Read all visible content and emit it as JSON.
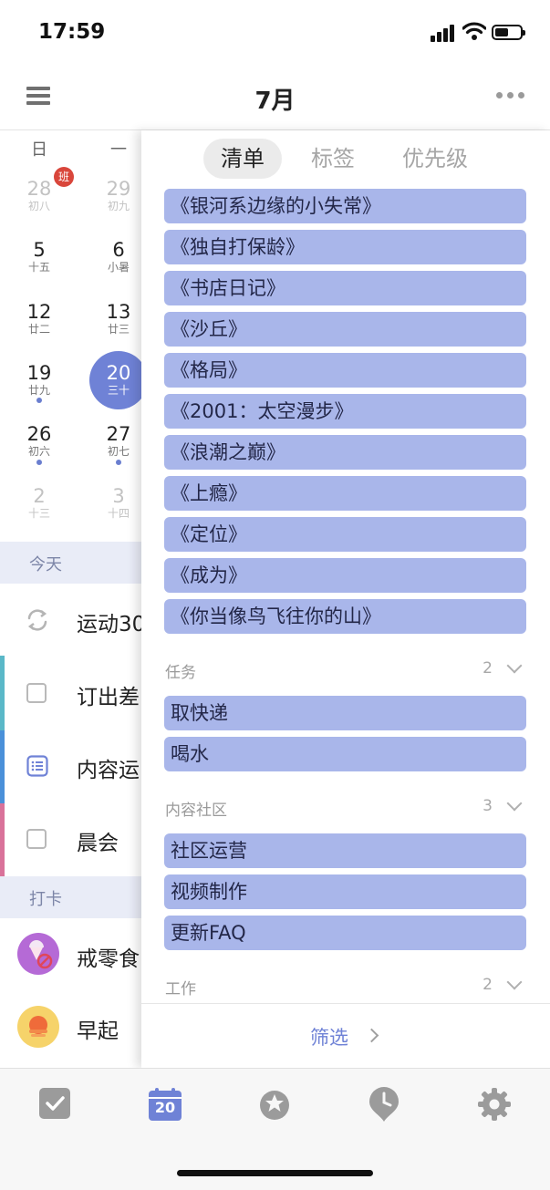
{
  "status": {
    "time": "17:59"
  },
  "header": {
    "title": "7月"
  },
  "calendar": {
    "weekdays": [
      "日",
      "一"
    ],
    "badge": "班",
    "rows": [
      [
        {
          "d": "28",
          "l": "初八",
          "dim": true
        },
        {
          "d": "29",
          "l": "初九",
          "dim": true
        }
      ],
      [
        {
          "d": "5",
          "l": "十五"
        },
        {
          "d": "6",
          "l": "小暑"
        }
      ],
      [
        {
          "d": "12",
          "l": "廿二"
        },
        {
          "d": "13",
          "l": "廿三"
        }
      ],
      [
        {
          "d": "19",
          "l": "廿九"
        },
        {
          "d": "20",
          "l": "三十",
          "selected": true
        }
      ],
      [
        {
          "d": "26",
          "l": "初六"
        },
        {
          "d": "27",
          "l": "初七"
        }
      ],
      [
        {
          "d": "2",
          "l": "十三",
          "dim": true
        },
        {
          "d": "3",
          "l": "十四",
          "dim": true
        }
      ]
    ]
  },
  "today": {
    "section_label": "今天",
    "tasks": [
      {
        "text": "运动30",
        "icon": "repeat-icon"
      },
      {
        "text": "订出差",
        "icon": "checkbox"
      },
      {
        "text": "内容运",
        "icon": "list-note-icon"
      },
      {
        "text": "晨会",
        "icon": "checkbox"
      }
    ]
  },
  "habits": {
    "section_label": "打卡",
    "items": [
      {
        "text": "戒零食",
        "icon": "no-snack-icon"
      },
      {
        "text": "早起",
        "icon": "sunrise-icon"
      }
    ]
  },
  "panel": {
    "segments": [
      "清单",
      "标签",
      "优先级"
    ],
    "active_segment": "清单",
    "lists": [
      "《银河系边缘的小失常》",
      "《独自打保龄》",
      "《书店日记》",
      "《沙丘》",
      "《格局》",
      "《2001：太空漫步》",
      "《浪潮之巅》",
      "《上瘾》",
      "《定位》",
      "《成为》",
      "《你当像鸟飞往你的山》"
    ],
    "groups": [
      {
        "name": "任务",
        "count": "2",
        "items": [
          "取快递",
          "喝水"
        ]
      },
      {
        "name": "内容社区",
        "count": "3",
        "items": [
          "社区运营",
          "视频制作",
          "更新FAQ"
        ]
      },
      {
        "name": "工作",
        "count": "2",
        "items": []
      }
    ],
    "filter_label": "筛选"
  },
  "tabbar": {
    "calendar_day": "20"
  },
  "colors": {
    "accent": "#6f82d6",
    "pill": "#a9b6ea",
    "badge": "#d9463b"
  }
}
